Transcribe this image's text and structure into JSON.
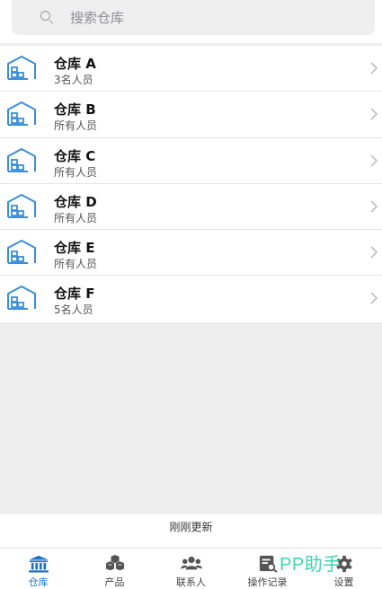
{
  "search": {
    "placeholder": "搜索仓库"
  },
  "warehouses": [
    {
      "name": "仓库 A",
      "sub": "3名人员"
    },
    {
      "name": "仓库 B",
      "sub": "所有人员"
    },
    {
      "name": "仓库 C",
      "sub": "所有人员"
    },
    {
      "name": "仓库 D",
      "sub": "所有人员"
    },
    {
      "name": "仓库 E",
      "sub": "所有人员"
    },
    {
      "name": "仓库 F",
      "sub": "5名人员"
    }
  ],
  "status": {
    "update_text": "刚刚更新"
  },
  "tabbar": {
    "tabs": [
      {
        "label": "仓库",
        "icon": "warehouse-icon",
        "active": true
      },
      {
        "label": "产品",
        "icon": "boxes-icon",
        "active": false
      },
      {
        "label": "联系人",
        "icon": "contacts-icon",
        "active": false
      },
      {
        "label": "操作记录",
        "icon": "log-icon",
        "active": false
      },
      {
        "label": "设置",
        "icon": "gear-icon",
        "active": false
      }
    ]
  },
  "watermark": {
    "text": "PP助手"
  },
  "colors": {
    "accent": "#1c72c7",
    "icon_blue": "#3a8fd8",
    "background": "#eeeeef"
  }
}
